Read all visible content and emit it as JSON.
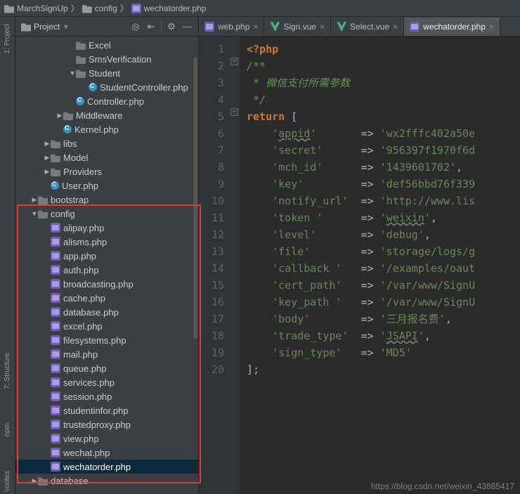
{
  "breadcrumb": [
    "MarchSignUp",
    "config",
    "wechatorder.php"
  ],
  "projectPanel": {
    "title": "Project",
    "toolbuttons": [
      "target",
      "collapse",
      "gear",
      "hide"
    ]
  },
  "tree": [
    {
      "d": 4,
      "a": "",
      "icon": "folder",
      "label": "Excel"
    },
    {
      "d": 4,
      "a": "",
      "icon": "folder",
      "label": "SmsVerification"
    },
    {
      "d": 4,
      "a": "▼",
      "icon": "folder",
      "label": "Student"
    },
    {
      "d": 5,
      "a": "",
      "icon": "class",
      "label": "StudentController.php"
    },
    {
      "d": 4,
      "a": "",
      "icon": "class",
      "label": "Controller.php"
    },
    {
      "d": 3,
      "a": "▶",
      "icon": "folder",
      "label": "Middleware"
    },
    {
      "d": 3,
      "a": "",
      "icon": "class",
      "label": "Kernel.php"
    },
    {
      "d": 2,
      "a": "▶",
      "icon": "folder",
      "label": "libs"
    },
    {
      "d": 2,
      "a": "▶",
      "icon": "folder",
      "label": "Model"
    },
    {
      "d": 2,
      "a": "▶",
      "icon": "folder",
      "label": "Providers"
    },
    {
      "d": 2,
      "a": "",
      "icon": "class",
      "label": "User.php"
    },
    {
      "d": 1,
      "a": "▶",
      "icon": "folder",
      "label": "bootstrap"
    },
    {
      "d": 1,
      "a": "▼",
      "icon": "folder",
      "label": "config"
    },
    {
      "d": 2,
      "a": "",
      "icon": "php",
      "label": "alipay.php"
    },
    {
      "d": 2,
      "a": "",
      "icon": "php",
      "label": "alisms.php"
    },
    {
      "d": 2,
      "a": "",
      "icon": "php",
      "label": "app.php"
    },
    {
      "d": 2,
      "a": "",
      "icon": "php",
      "label": "auth.php"
    },
    {
      "d": 2,
      "a": "",
      "icon": "php",
      "label": "broadcasting.php"
    },
    {
      "d": 2,
      "a": "",
      "icon": "php",
      "label": "cache.php"
    },
    {
      "d": 2,
      "a": "",
      "icon": "php",
      "label": "database.php"
    },
    {
      "d": 2,
      "a": "",
      "icon": "php",
      "label": "excel.php"
    },
    {
      "d": 2,
      "a": "",
      "icon": "php",
      "label": "filesystems.php"
    },
    {
      "d": 2,
      "a": "",
      "icon": "php",
      "label": "mail.php"
    },
    {
      "d": 2,
      "a": "",
      "icon": "php",
      "label": "queue.php"
    },
    {
      "d": 2,
      "a": "",
      "icon": "php",
      "label": "services.php"
    },
    {
      "d": 2,
      "a": "",
      "icon": "php",
      "label": "session.php"
    },
    {
      "d": 2,
      "a": "",
      "icon": "php",
      "label": "studentinfor.php"
    },
    {
      "d": 2,
      "a": "",
      "icon": "php",
      "label": "trustedproxy.php"
    },
    {
      "d": 2,
      "a": "",
      "icon": "php",
      "label": "view.php"
    },
    {
      "d": 2,
      "a": "",
      "icon": "php",
      "label": "wechat.php"
    },
    {
      "d": 2,
      "a": "",
      "icon": "php",
      "label": "wechatorder.php",
      "sel": true
    },
    {
      "d": 1,
      "a": "▶",
      "icon": "folder",
      "label": "database"
    }
  ],
  "tabs": [
    {
      "icon": "php",
      "label": "web.php",
      "active": false
    },
    {
      "icon": "vue",
      "label": "Sign.vue",
      "active": false
    },
    {
      "icon": "vue",
      "label": "Select.vue",
      "active": false
    },
    {
      "icon": "php",
      "label": "wechatorder.php",
      "active": true
    }
  ],
  "code": {
    "lines": [
      {
        "n": 1,
        "html": "<span class='c-tag'>&lt;?php</span>"
      },
      {
        "n": 2,
        "html": "<span class='c-cm'>/**</span>"
      },
      {
        "n": 3,
        "html": "<span class='c-cm'> * 微信支付所需参数</span>"
      },
      {
        "n": 4,
        "html": "<span class='c-cm'> */</span>"
      },
      {
        "n": 5,
        "html": "<span class='c-kw'>return</span> <span class='c-op'>[</span>"
      },
      {
        "n": 6,
        "html": "    <span class='c-str'>'<span class='c-und'>appid</span>'</span>       <span class='c-op'>=&gt;</span> <span class='c-str'>'wx2fffc402a50e</span>"
      },
      {
        "n": 7,
        "html": "    <span class='c-str'>'secret'</span>      <span class='c-op'>=&gt;</span> <span class='c-str'>'956397f1970f6d</span>"
      },
      {
        "n": 8,
        "html": "    <span class='c-str'>'mch_id'</span>      <span class='c-op'>=&gt;</span> <span class='c-str'>'1439601702'</span><span class='c-op'>,</span>"
      },
      {
        "n": 9,
        "html": "    <span class='c-str'>'key'</span>         <span class='c-op'>=&gt;</span> <span class='c-str'>'def56bbd76f339</span>"
      },
      {
        "n": 10,
        "html": "    <span class='c-str'>'notify_url'</span>  <span class='c-op'>=&gt;</span> <span class='c-str'>'http://www.lis</span>"
      },
      {
        "n": 11,
        "html": "    <span class='c-str'>'token '</span>      <span class='c-op'>=&gt;</span> <span class='c-str'>'<span class='c-und'>weixin</span>'</span><span class='c-op'>,</span>"
      },
      {
        "n": 12,
        "html": "    <span class='c-str'>'level'</span>       <span class='c-op'>=&gt;</span> <span class='c-str'>'debug'</span><span class='c-op'>,</span>"
      },
      {
        "n": 13,
        "html": "    <span class='c-str'>'file'</span>        <span class='c-op'>=&gt;</span> <span class='c-str'>'storage/logs/g</span>"
      },
      {
        "n": 14,
        "html": "    <span class='c-str'>'callback '</span>   <span class='c-op'>=&gt;</span> <span class='c-str'>'/examples/oaut</span>"
      },
      {
        "n": 15,
        "html": "    <span class='c-str'>'cert_path'</span>   <span class='c-op'>=&gt;</span> <span class='c-str'>'/var/www/SignU</span>"
      },
      {
        "n": 16,
        "html": "    <span class='c-str'>'key_path '</span>   <span class='c-op'>=&gt;</span> <span class='c-str'>'/var/www/SignU</span>"
      },
      {
        "n": 17,
        "html": "    <span class='c-str'>'body'</span>        <span class='c-op'>=&gt;</span> <span class='c-str'>'三月报名费'</span><span class='c-op'>,</span>"
      },
      {
        "n": 18,
        "html": "    <span class='c-str'>'trade_type'</span>  <span class='c-op'>=&gt;</span> <span class='c-str'>'<span class='c-und'>JSAPI</span>'</span><span class='c-op'>,</span>"
      },
      {
        "n": 19,
        "html": "    <span class='c-str'>'sign_type'</span>   <span class='c-op'>=&gt;</span> <span class='c-str'>'MD5'</span>"
      },
      {
        "n": 20,
        "html": "<span class='c-op'>];</span>"
      }
    ]
  },
  "sideTools": {
    "top": "1: Project",
    "mid": "7: Structure",
    "bot": "npm",
    "far": "vorites"
  },
  "watermark": "https://blog.csdn.net/weixin_43885417"
}
